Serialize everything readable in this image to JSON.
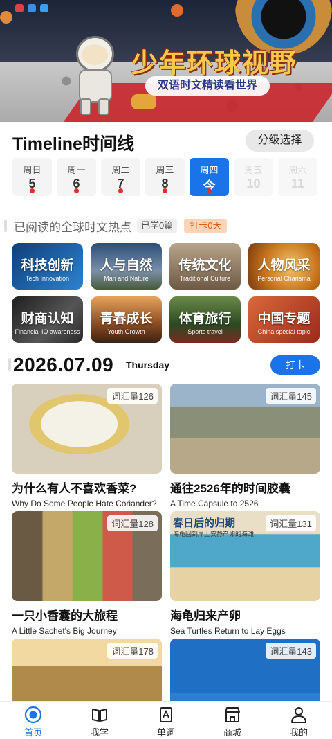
{
  "banner": {
    "title": "少年环球视野",
    "subtitle": "双语时文精读看世界"
  },
  "timeline": {
    "title": "Timeline时间线",
    "grade_button": "分级选择",
    "days": [
      {
        "name": "周日",
        "date": "5",
        "dot": true,
        "state": "past"
      },
      {
        "name": "周一",
        "date": "6",
        "dot": true,
        "state": "past"
      },
      {
        "name": "周二",
        "date": "7",
        "dot": true,
        "state": "past"
      },
      {
        "name": "周三",
        "date": "8",
        "dot": true,
        "state": "past"
      },
      {
        "name": "周四",
        "date": "今",
        "dot": true,
        "state": "today"
      },
      {
        "name": "周五",
        "date": "10",
        "dot": false,
        "state": "future"
      },
      {
        "name": "周六",
        "date": "11",
        "dot": false,
        "state": "future"
      }
    ]
  },
  "reading": {
    "title": "已阅读的全球时文热点",
    "learned": "已学0篇",
    "checkin": "打卡0天"
  },
  "categories": [
    {
      "zh": "科技创新",
      "en": "Tech Innovation",
      "color": "#1d5fa8"
    },
    {
      "zh": "人与自然",
      "en": "Man and Nature",
      "color": "#2b5a8c"
    },
    {
      "zh": "传统文化",
      "en": "Traditional Culture",
      "color": "#8a6a48"
    },
    {
      "zh": "人物风采",
      "en": "Personal Charisma",
      "color": "#c07a22"
    },
    {
      "zh": "财商认知",
      "en": "Financial IQ awareness",
      "color": "#3a3a3a"
    },
    {
      "zh": "青春成长",
      "en": "Youth Growth",
      "color": "#7a4a2a"
    },
    {
      "zh": "体育旅行",
      "en": "Sports travel",
      "color": "#3d6b2f"
    },
    {
      "zh": "中国专题",
      "en": "China special topic",
      "color": "#b84a2a"
    }
  ],
  "date_section": {
    "date": "2026.07.09",
    "weekday": "Thursday",
    "checkin_button": "打卡"
  },
  "articles": [
    {
      "vocab": "词汇量126",
      "zh": "为什么有人不喜欢香菜?",
      "en": "Why Do Some People Hate Coriander?",
      "color": "#d8c59a"
    },
    {
      "vocab": "词汇量145",
      "zh": "通往2526年的时间胶囊",
      "en": "A Time Capsule to 2526",
      "color": "#8a8f78"
    },
    {
      "vocab": "词汇量128",
      "zh": "一只小香囊的大旅程",
      "en": "A Little Sachet's Big Journey",
      "color": "#7a6e5a"
    },
    {
      "vocab": "词汇量131",
      "zh": "海龟归来产卵",
      "en": "Sea Turtles Return to Lay Eggs",
      "color": "#6bb5c9",
      "thumb_text": "春日后的归期",
      "thumb_sub": "海龟回到岸上安静产卵的海滩"
    },
    {
      "vocab": "词汇量178",
      "zh": "",
      "en": "",
      "color": "#b08a4a"
    },
    {
      "vocab": "词汇量143",
      "zh": "",
      "en": "",
      "color": "#2a7fd0"
    }
  ],
  "tabs": [
    {
      "label": "首页",
      "icon": "home-icon",
      "active": true
    },
    {
      "label": "我学",
      "icon": "book-icon",
      "active": false
    },
    {
      "label": "单词",
      "icon": "word-card-icon",
      "active": false
    },
    {
      "label": "商城",
      "icon": "shop-icon",
      "active": false
    },
    {
      "label": "我的",
      "icon": "profile-icon",
      "active": false
    }
  ],
  "colors": {
    "accent": "#1a73e8",
    "dot": "#e0302a",
    "checkin_bg": "#fbd5b5",
    "checkin_text": "#e55a18"
  }
}
